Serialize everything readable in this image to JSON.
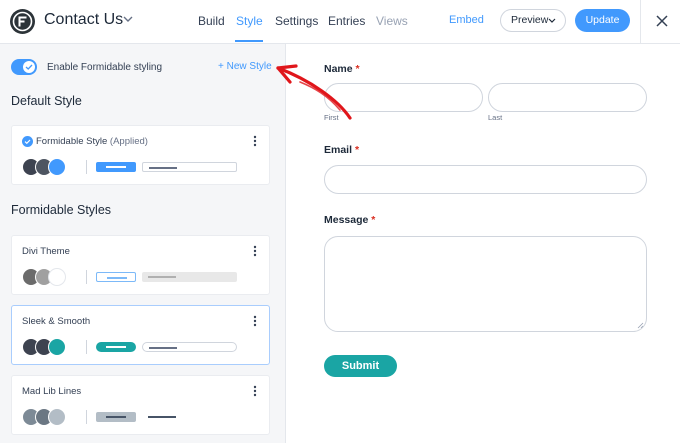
{
  "header": {
    "form_title": "Contact Us",
    "tabs": [
      {
        "label": "Build",
        "state": "normal"
      },
      {
        "label": "Style",
        "state": "active"
      },
      {
        "label": "Settings",
        "state": "normal"
      },
      {
        "label": "Entries",
        "state": "normal"
      },
      {
        "label": "Views",
        "state": "disabled"
      }
    ],
    "embed_label": "Embed",
    "preview_label": "Preview",
    "update_label": "Update"
  },
  "sidebar": {
    "toggle_label": "Enable Formidable styling",
    "toggle_on": true,
    "new_style_label": "+ New Style",
    "default_section_title": "Default Style",
    "styles_section_title": "Formidable Styles",
    "default_card": {
      "name": "Formidable Style",
      "status": "(Applied)",
      "swatches": [
        "#3d4350",
        "#4e5561",
        "#4199fd"
      ],
      "button_color": "#4199fd",
      "button_line_color": "#ffffff",
      "field_bg": "#ffffff",
      "field_line_color": "#667085"
    },
    "style_cards": [
      {
        "name": "Divi Theme",
        "swatches": [
          "#6b6b6b",
          "#a0a0a0",
          "#ffffff"
        ],
        "button_color": "#ffffff",
        "button_border": "#7cb9f8",
        "button_line_color": "#7cb9f8",
        "field_bg": "#e8e8e8",
        "field_line_color": "#b0b0b0",
        "selected": false
      },
      {
        "name": "Sleek & Smooth",
        "swatches": [
          "#3d4350",
          "#3d4350",
          "#1aa5a4"
        ],
        "button_color": "#1aa5a4",
        "button_border": "#1aa5a4",
        "button_line_color": "#ffffff",
        "field_bg": "#ffffff",
        "field_line_color": "#667085",
        "selected": true
      },
      {
        "name": "Mad Lib Lines",
        "swatches": [
          "#7d8a96",
          "#6b7783",
          "#b3bdc6"
        ],
        "button_color": "#b3bdc6",
        "button_border": "#b3bdc6",
        "button_line_color": "#475467",
        "field_bg": "#ffffff",
        "field_line_color": "#475467",
        "selected": false
      }
    ]
  },
  "form": {
    "name_label": "Name",
    "first_label": "First",
    "last_label": "Last",
    "email_label": "Email",
    "message_label": "Message",
    "required_mark": "*",
    "submit_label": "Submit"
  },
  "colors": {
    "accent": "#4199fd",
    "submit": "#1aa5a4",
    "annotation_arrow": "#e0161b"
  }
}
